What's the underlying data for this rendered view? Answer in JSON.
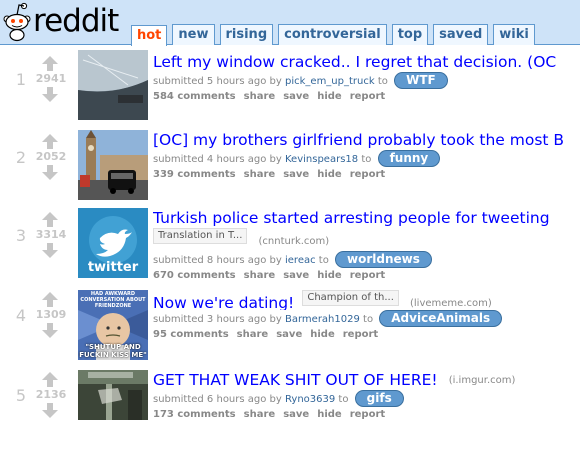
{
  "header": {
    "logo_text": "reddit",
    "tabs": [
      {
        "label": "hot",
        "selected": true
      },
      {
        "label": "new",
        "selected": false
      },
      {
        "label": "rising",
        "selected": false
      },
      {
        "label": "controversial",
        "selected": false
      },
      {
        "label": "top",
        "selected": false
      },
      {
        "label": "saved",
        "selected": false
      },
      {
        "label": "wiki",
        "selected": false
      }
    ]
  },
  "colors": {
    "header_bg": "#cee3f8",
    "link": "#0000ff",
    "selected_tab": "#ff4500",
    "subreddit_pill": "#5f99cf"
  },
  "posts": [
    {
      "rank": "1",
      "score": "2941",
      "title": "Left my window cracked.. I regret that decision. (OC",
      "flair": "",
      "domain": "",
      "submitted": "submitted 5 hours ago by",
      "author": "pick_em_up_truck",
      "to": "to",
      "subreddit": "WTF",
      "comments": "584 comments",
      "share": "share",
      "save": "save",
      "hide": "hide",
      "report": "report",
      "thumb_icon": "car-window-icon"
    },
    {
      "rank": "2",
      "score": "2052",
      "title": "[OC] my brothers girlfriend probably took the most B",
      "flair": "",
      "domain": "",
      "submitted": "submitted 4 hours ago by",
      "author": "Kevinspears18",
      "to": "to",
      "subreddit": "funny",
      "comments": "339 comments",
      "share": "share",
      "save": "save",
      "hide": "hide",
      "report": "report",
      "thumb_icon": "london-street-icon"
    },
    {
      "rank": "3",
      "score": "3314",
      "title": "Turkish police started arresting people for tweeting",
      "flair": "Translation in T...",
      "domain": "(cnnturk.com)",
      "submitted": "submitted 8 hours ago by",
      "author": "iereac",
      "to": "to",
      "subreddit": "worldnews",
      "comments": "670 comments",
      "share": "share",
      "save": "save",
      "hide": "hide",
      "report": "report",
      "thumb_icon": "twitter-bird-icon",
      "thumb_text": "twitter"
    },
    {
      "rank": "4",
      "score": "1309",
      "title": "Now we're dating!",
      "flair": "Champion of th...",
      "domain": "(livememe.com)",
      "submitted": "submitted 3 hours ago by",
      "author": "Barmerah1029",
      "to": "to",
      "subreddit": "AdviceAnimals",
      "comments": "95 comments",
      "share": "share",
      "save": "save",
      "hide": "hide",
      "report": "report",
      "thumb_icon": "success-kid-meme-icon",
      "thumb_top": "HAD AWKWARD CONVERSATION ABOUT FRIENDZONE",
      "thumb_bottom": "\"SHUTUP AND FUCKIN KISS ME\""
    },
    {
      "rank": "5",
      "score": "2136",
      "title": "GET THAT WEAK SHIT OUT OF HERE!",
      "flair": "",
      "domain": "(i.imgur.com)",
      "submitted": "submitted 6 hours ago by",
      "author": "Ryno3639",
      "to": "to",
      "subreddit": "gifs",
      "comments": "173 comments",
      "share": "share",
      "save": "save",
      "hide": "hide",
      "report": "report",
      "thumb_icon": "basketball-block-icon"
    }
  ]
}
